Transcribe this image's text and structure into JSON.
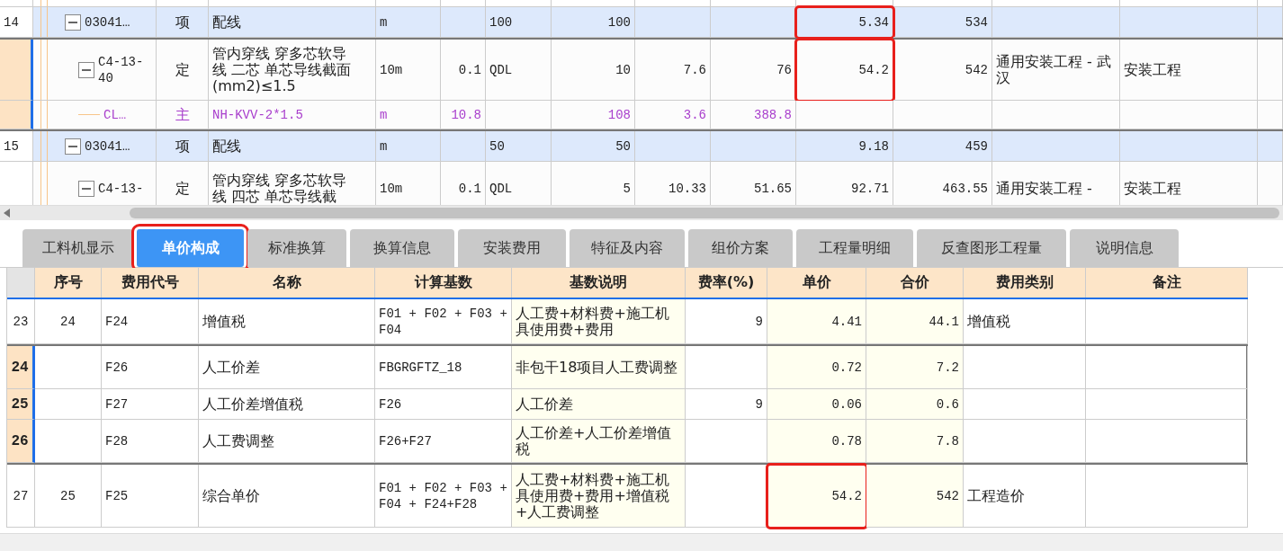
{
  "item_grid": {
    "rows": [
      {
        "row_no": "14",
        "code": "03041…",
        "type": "项",
        "name": "配线",
        "unit": "m",
        "column_6": "100",
        "column_7": "100",
        "unit_price": "5.34",
        "total": "534",
        "unit_price_highlighted": true,
        "expanded": true,
        "selected": false,
        "children": [
          {
            "code": "C4-13-40",
            "type": "定",
            "name": "管内穿线 穿多芯软导线 二芯 单芯导线截面(mm2)≤1.5",
            "unit": "10m",
            "column_5": "0.1",
            "column_6": "QDL",
            "column_7": "10",
            "column_8": "7.6",
            "column_9": "76",
            "unit_price": "54.2",
            "total": "542",
            "column_12": "通用安装工程 - 武汉",
            "column_13": "安装工程",
            "unit_price_highlighted": true,
            "expanded": true,
            "selected": true,
            "children": [
              {
                "code": "CL…",
                "type": "主",
                "name": "NH-KVV-2*1.5",
                "unit": "m",
                "column_5": "10.8",
                "column_7": "108",
                "column_8": "3.6",
                "column_9": "388.8",
                "unit_price_highlighted": false,
                "selected": true
              }
            ]
          }
        ]
      },
      {
        "row_no": "15",
        "code": "03041…",
        "type": "项",
        "name": "配线",
        "unit": "m",
        "column_6": "50",
        "column_7": "50",
        "unit_price": "9.18",
        "total": "459",
        "unit_price_highlighted": false,
        "expanded": true,
        "selected": false,
        "children": [
          {
            "code": "C4-13-",
            "type": "定",
            "name": "管内穿线 穿多芯软导线 四芯 单芯导线截",
            "unit": "10m",
            "column_5": "0.1",
            "column_6": "QDL",
            "column_7": "5",
            "column_8": "10.33",
            "column_9": "51.65",
            "unit_price": "92.71",
            "total": "463.55",
            "column_12": "通用安装工程 -",
            "column_13": "安装工程",
            "unit_price_highlighted": false,
            "expanded": true,
            "selected": false
          }
        ]
      }
    ]
  },
  "tabs": [
    {
      "label": "工料机显示",
      "selected": false,
      "highlighted": false
    },
    {
      "label": "单价构成",
      "selected": true,
      "highlighted": true
    },
    {
      "label": "标准换算",
      "selected": false,
      "highlighted": false
    },
    {
      "label": "换算信息",
      "selected": false,
      "highlighted": false
    },
    {
      "label": "安装费用",
      "selected": false,
      "highlighted": false
    },
    {
      "label": "特征及内容",
      "selected": false,
      "highlighted": false
    },
    {
      "label": "组价方案",
      "selected": false,
      "highlighted": false
    },
    {
      "label": "工程量明细",
      "selected": false,
      "highlighted": false
    },
    {
      "label": "反查图形工程量",
      "selected": false,
      "highlighted": false
    },
    {
      "label": "说明信息",
      "selected": false,
      "highlighted": false
    }
  ],
  "price_table": {
    "columns": [
      "序号",
      "费用代号",
      "名称",
      "计算基数",
      "基数说明",
      "费率(%)",
      "单价",
      "合价",
      "费用类别",
      "备注"
    ],
    "rows": [
      {
        "row_no": "23",
        "seq": "24",
        "code": "F24",
        "name": "增值税",
        "base": "F01 + F02 + F03 + F04",
        "base_desc": "人工费+材料费+施工机具使用费+费用",
        "rate": "9",
        "unit_price": "4.41",
        "total": "44.1",
        "category": "增值税",
        "selected": false,
        "unit_price_highlighted": false
      },
      {
        "row_no": "24",
        "code": "F26",
        "name": "人工价差",
        "base": "FBGRGFTZ_18",
        "base_desc": "非包干18项目人工费调整",
        "unit_price": "0.72",
        "total": "7.2",
        "selected": true,
        "unit_price_highlighted": false
      },
      {
        "row_no": "25",
        "code": "F27",
        "name": "人工价差增值税",
        "base": "F26",
        "base_desc": "人工价差",
        "rate": "9",
        "unit_price": "0.06",
        "total": "0.6",
        "selected": true,
        "unit_price_highlighted": false
      },
      {
        "row_no": "26",
        "code": "F28",
        "name": "人工费调整",
        "base": "F26+F27",
        "base_desc": "人工价差+人工价差增值税",
        "unit_price": "0.78",
        "total": "7.8",
        "selected": true,
        "unit_price_highlighted": false
      },
      {
        "row_no": "27",
        "seq": "25",
        "code": "F25",
        "name": "综合单价",
        "base": "F01 + F02 + F03 + F04 + F24+F28",
        "base_desc": "人工费+材料费+施工机具使用费+费用+增值税+人工费调整",
        "unit_price": "54.2",
        "total": "542",
        "category": "工程造价",
        "selected": false,
        "unit_price_highlighted": true
      }
    ]
  }
}
